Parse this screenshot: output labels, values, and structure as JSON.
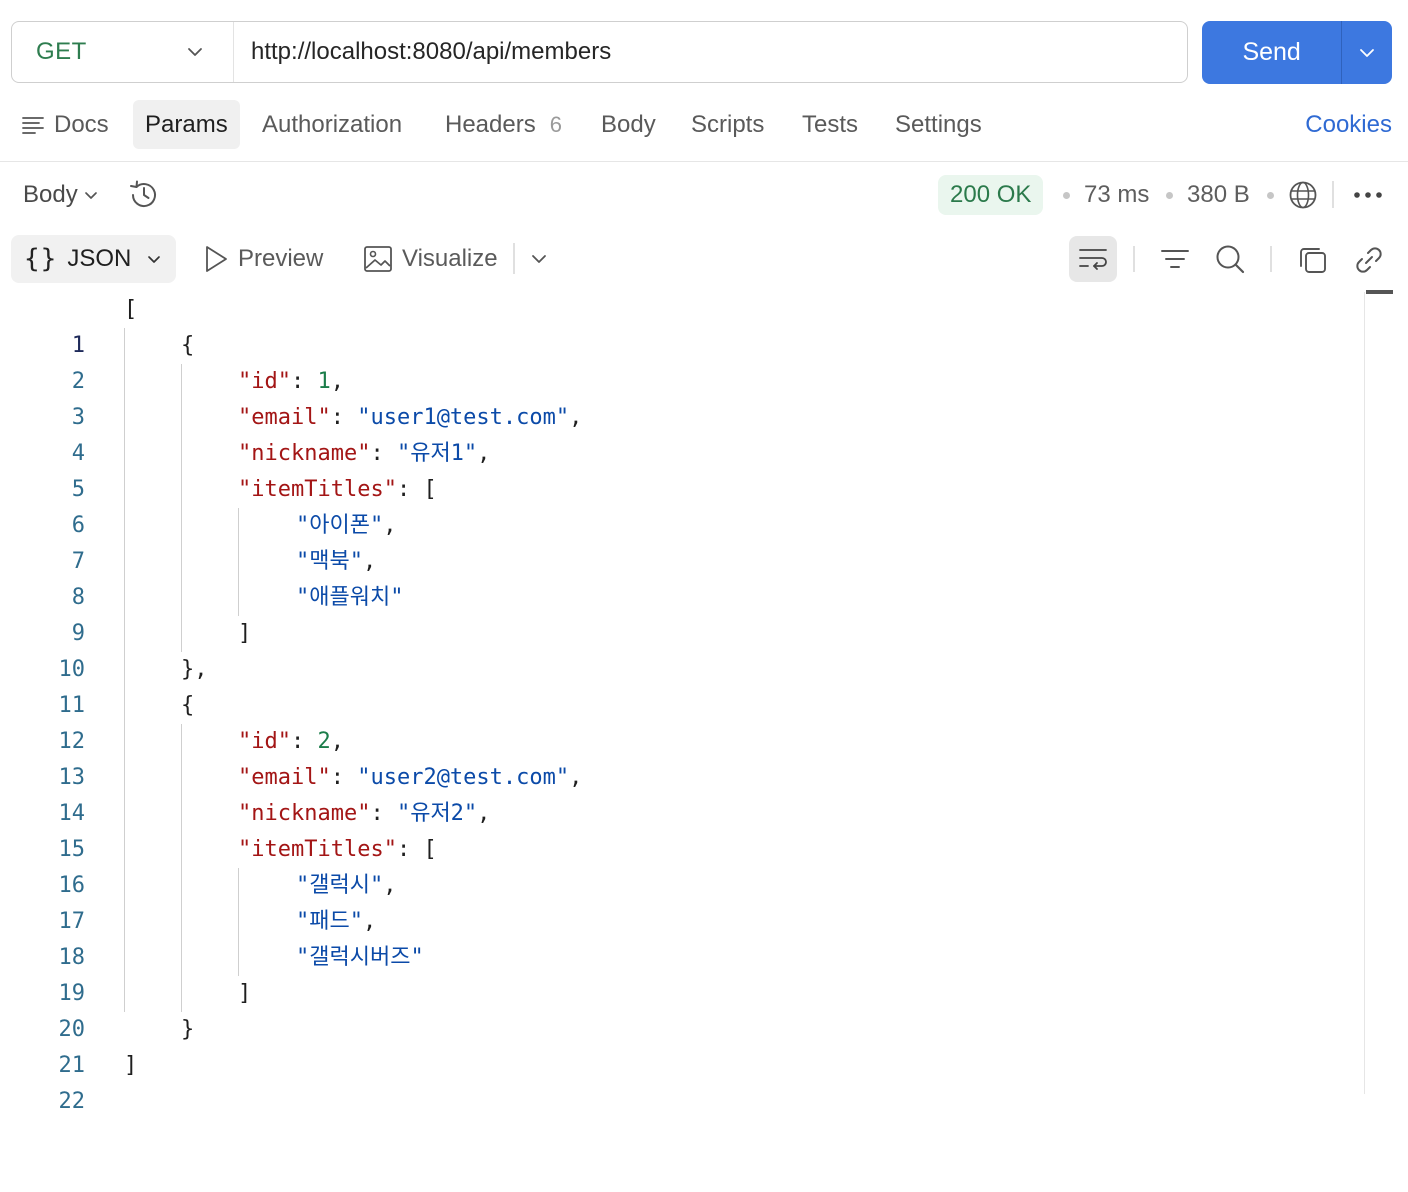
{
  "request": {
    "method": "GET",
    "url": "http://localhost:8080/api/members",
    "send_label": "Send"
  },
  "tabs": {
    "docs": "Docs",
    "params": "Params",
    "authorization": "Authorization",
    "headers": "Headers",
    "headers_count": "6",
    "body": "Body",
    "scripts": "Scripts",
    "tests": "Tests",
    "settings": "Settings",
    "cookies": "Cookies",
    "active": "Params"
  },
  "response": {
    "section_label": "Body",
    "status": "200 OK",
    "time": "73 ms",
    "size": "380 B",
    "view_mode": "JSON",
    "preview_label": "Preview",
    "visualize_label": "Visualize"
  },
  "code": {
    "line_numbers": [
      "1",
      "2",
      "3",
      "4",
      "5",
      "6",
      "7",
      "8",
      "9",
      "10",
      "11",
      "12",
      "13",
      "14",
      "15",
      "16",
      "17",
      "18",
      "19",
      "20",
      "21",
      "22"
    ],
    "members": [
      {
        "id": "1",
        "email": "\"user1@test.com\"",
        "nickname": "\"유저1\"",
        "items": [
          "\"아이폰\"",
          "\"맥북\"",
          "\"애플워치\""
        ]
      },
      {
        "id": "2",
        "email": "\"user2@test.com\"",
        "nickname": "\"유저2\"",
        "items": [
          "\"갤럭시\"",
          "\"패드\"",
          "\"갤럭시버즈\""
        ]
      }
    ],
    "keys": {
      "id": "\"id\"",
      "email": "\"email\"",
      "nickname": "\"nickname\"",
      "itemTitles": "\"itemTitles\""
    }
  },
  "colors": {
    "send_button": "#3d78e0",
    "method_get": "#2e7d4f",
    "status_ok_bg": "#eaf6ee",
    "status_ok_text": "#2b7a4b",
    "json_key": "#a31515",
    "json_string": "#0b4aa8",
    "json_number": "#1b7d4a",
    "cookies_link": "#2f6ad3"
  }
}
